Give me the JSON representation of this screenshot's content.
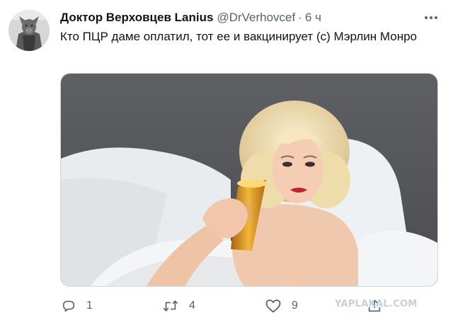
{
  "author": {
    "display_name": "Доктор Верховцев Lanius",
    "handle": "@DrVerhovcef",
    "separator": "·",
    "time": "6 ч"
  },
  "tweet": {
    "text": "Кто ПЦР даме оплатил, тот ее и вакцинирует (с) Мэрлин Монро"
  },
  "actions": {
    "replies": "1",
    "retweets": "4",
    "likes": "9"
  },
  "watermark": "YAPLAKAL.COM",
  "icons": {
    "more": "more-icon",
    "reply": "reply-icon",
    "retweet": "retweet-icon",
    "like": "heart-icon",
    "share": "share-icon"
  },
  "colors": {
    "text_primary": "#0f1419",
    "text_secondary": "#536471",
    "border": "#cfd9de",
    "watermark": "#c5d0da"
  }
}
